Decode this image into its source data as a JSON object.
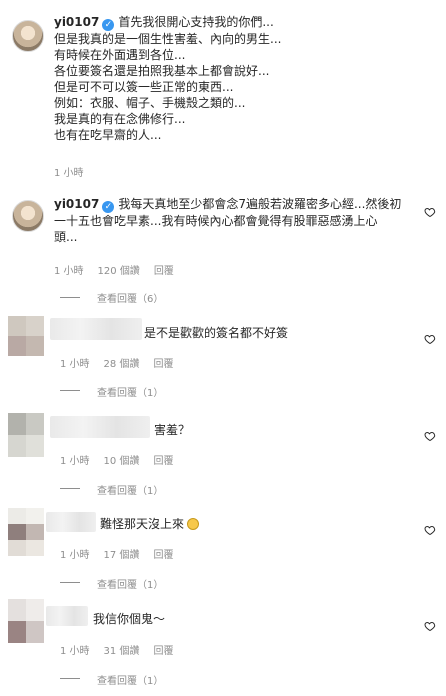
{
  "comment1": {
    "username": "yi0107",
    "lines": [
      "首先我很開心支持我的你們...",
      "但是我真的是一個生性害羞、內向的男生...",
      "有時候在外面遇到各位...",
      "各位要簽名還是拍照我基本上都會說好...",
      "但是可不可以簽一些正常的東西...",
      "例如：衣服、帽子、手機殼之類的...",
      "我是真的有在念佛修行...",
      "也有在吃早齋的人..."
    ],
    "time": "1 小時"
  },
  "comment2": {
    "username": "yi0107",
    "lines": [
      "我每天真地至少都會念7遍般若波羅密多心經...然後初",
      "一十五也會吃早素...我有時候內心都會覺得有股罪惡感湧上心",
      "頭..."
    ],
    "time": "1 小時",
    "likes": "120 個讚",
    "reply": "回覆",
    "view_replies": "查看回覆（6）"
  },
  "replies": [
    {
      "text": "是不是歡歡的簽名都不好簽",
      "time": "1 小時",
      "likes": "28 個讚",
      "reply": "回覆",
      "view_replies": "查看回覆（1）"
    },
    {
      "text": "害羞？",
      "time": "1 小時",
      "likes": "10 個讚",
      "reply": "回覆",
      "view_replies": "查看回覆（1）"
    },
    {
      "text": "難怪那天沒上來",
      "time": "1 小時",
      "likes": "17 個讚",
      "reply": "回覆",
      "view_replies": "查看回覆（1）"
    },
    {
      "text": "我信你個鬼～",
      "time": "1 小時",
      "likes": "31 個讚",
      "reply": "回覆",
      "view_replies": "查看回覆（1）"
    }
  ],
  "colors": {
    "text": "#262626",
    "meta": "#8e8e8e",
    "verified": "#3897f0"
  }
}
